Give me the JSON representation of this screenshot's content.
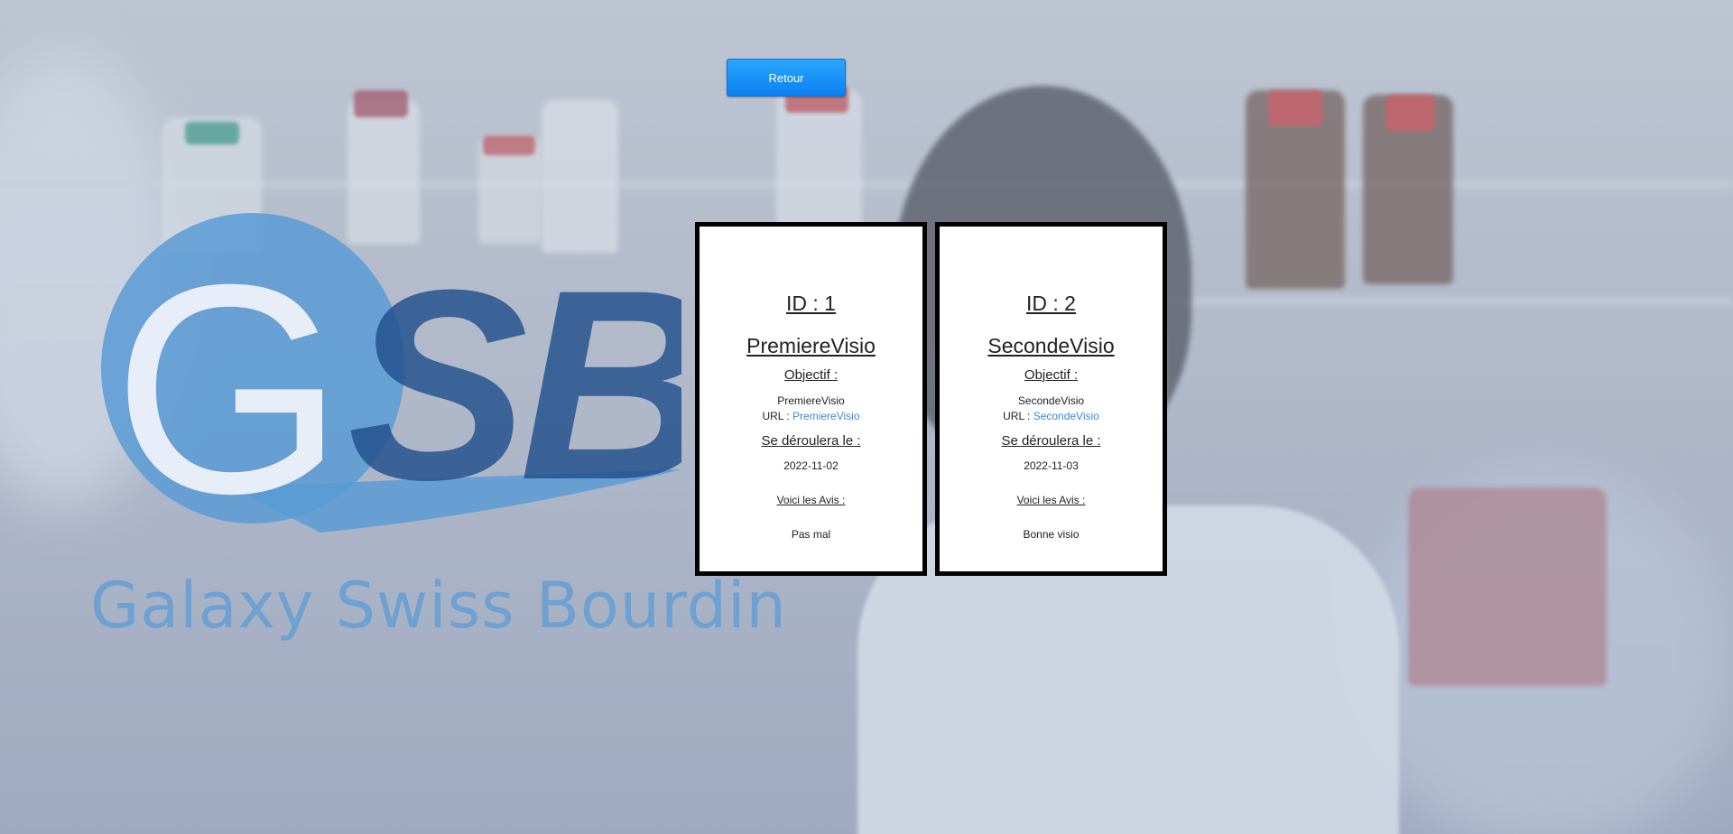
{
  "retour_label": "Retour",
  "logo": {
    "letters": "GSB",
    "subtitle": "Galaxy Swiss Bourdin"
  },
  "cards": [
    {
      "id_label": "ID : 1",
      "title": "PremiereVisio",
      "objectif_label": "Objectif :",
      "objectif": "PremiereVisio",
      "url_label": "URL : ",
      "url_text": "PremiereVisio",
      "date_label": "Se déroulera le :",
      "date": "2022-11-02",
      "avis_label": "Voici les Avis :",
      "avis": "Pas mal"
    },
    {
      "id_label": "ID : 2",
      "title": "SecondeVisio",
      "objectif_label": "Objectif :",
      "objectif": "SecondeVisio",
      "url_label": "URL : ",
      "url_text": "SecondeVisio",
      "date_label": "Se déroulera le :",
      "date": "2022-11-03",
      "avis_label": "Voici les Avis :",
      "avis": "Bonne visio"
    }
  ],
  "colors": {
    "button": "#0a7ff0",
    "logo_light": "#5b9bd5",
    "logo_dark": "#1f4e8c",
    "link": "#3a87d6"
  }
}
